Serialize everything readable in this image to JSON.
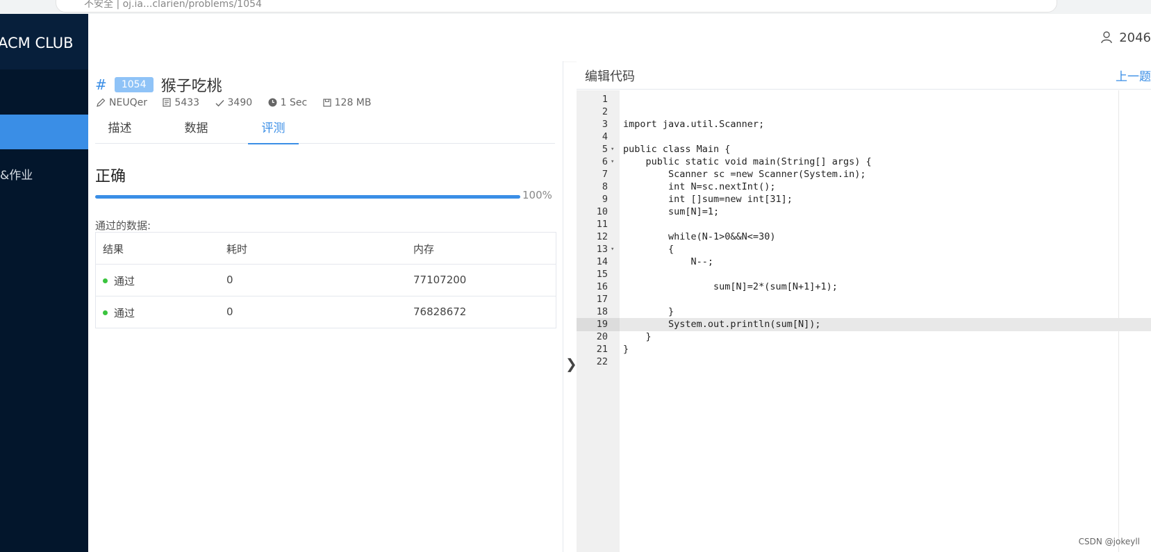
{
  "browser": {
    "address": "不安全 | oj.ia...clarien/problems/1054"
  },
  "sidebar": {
    "brand": "ACM CLUB",
    "items": [
      {
        "label": ""
      },
      {
        "label": "&作业"
      }
    ]
  },
  "header": {
    "user": "2046"
  },
  "problem": {
    "hash": "#",
    "id": "1054",
    "title": "猴子吃桃",
    "meta": {
      "author": "NEUQer",
      "submissions": "5433",
      "accepted": "3490",
      "time_limit": "1 Sec",
      "memory_limit": "128 MB"
    },
    "tabs": [
      {
        "label": "描述"
      },
      {
        "label": "数据"
      },
      {
        "label": "评测"
      }
    ],
    "active_tab": "评测"
  },
  "judge": {
    "verdict": "正确",
    "progress": 100,
    "progress_label": "100%",
    "passed_label": "通过的数据:",
    "columns": [
      "结果",
      "耗时",
      "内存"
    ],
    "rows": [
      {
        "result": "通过",
        "time": "0",
        "memory": "77107200"
      },
      {
        "result": "通过",
        "time": "0",
        "memory": "76828672"
      }
    ]
  },
  "editor": {
    "title": "编辑代码",
    "next_label": "上一题",
    "active_line": 19,
    "lines": [
      {
        "n": "1",
        "code": ""
      },
      {
        "n": "2",
        "code": ""
      },
      {
        "n": "3",
        "code": "import java.util.Scanner;"
      },
      {
        "n": "4",
        "code": ""
      },
      {
        "n": "5",
        "code": "public class Main {",
        "fold": true
      },
      {
        "n": "6",
        "code": "    public static void main(String[] args) {",
        "fold": true
      },
      {
        "n": "7",
        "code": "        Scanner sc =new Scanner(System.in);"
      },
      {
        "n": "8",
        "code": "        int N=sc.nextInt();"
      },
      {
        "n": "9",
        "code": "        int []sum=new int[31];"
      },
      {
        "n": "10",
        "code": "        sum[N]=1;"
      },
      {
        "n": "11",
        "code": ""
      },
      {
        "n": "12",
        "code": "        while(N-1>0&&N<=30)"
      },
      {
        "n": "13",
        "code": "        {",
        "fold": true
      },
      {
        "n": "14",
        "code": "            N--;"
      },
      {
        "n": "15",
        "code": ""
      },
      {
        "n": "16",
        "code": "                sum[N]=2*(sum[N+1]+1);"
      },
      {
        "n": "17",
        "code": ""
      },
      {
        "n": "18",
        "code": "        }"
      },
      {
        "n": "19",
        "code": "        System.out.println(sum[N]);"
      },
      {
        "n": "20",
        "code": "    }"
      },
      {
        "n": "21",
        "code": "}"
      },
      {
        "n": "22",
        "code": ""
      }
    ]
  },
  "watermark": "CSDN @jokeyll",
  "colors": {
    "accent": "#3a8ee6",
    "sidebar": "#03162c",
    "success": "#3ac43e"
  }
}
